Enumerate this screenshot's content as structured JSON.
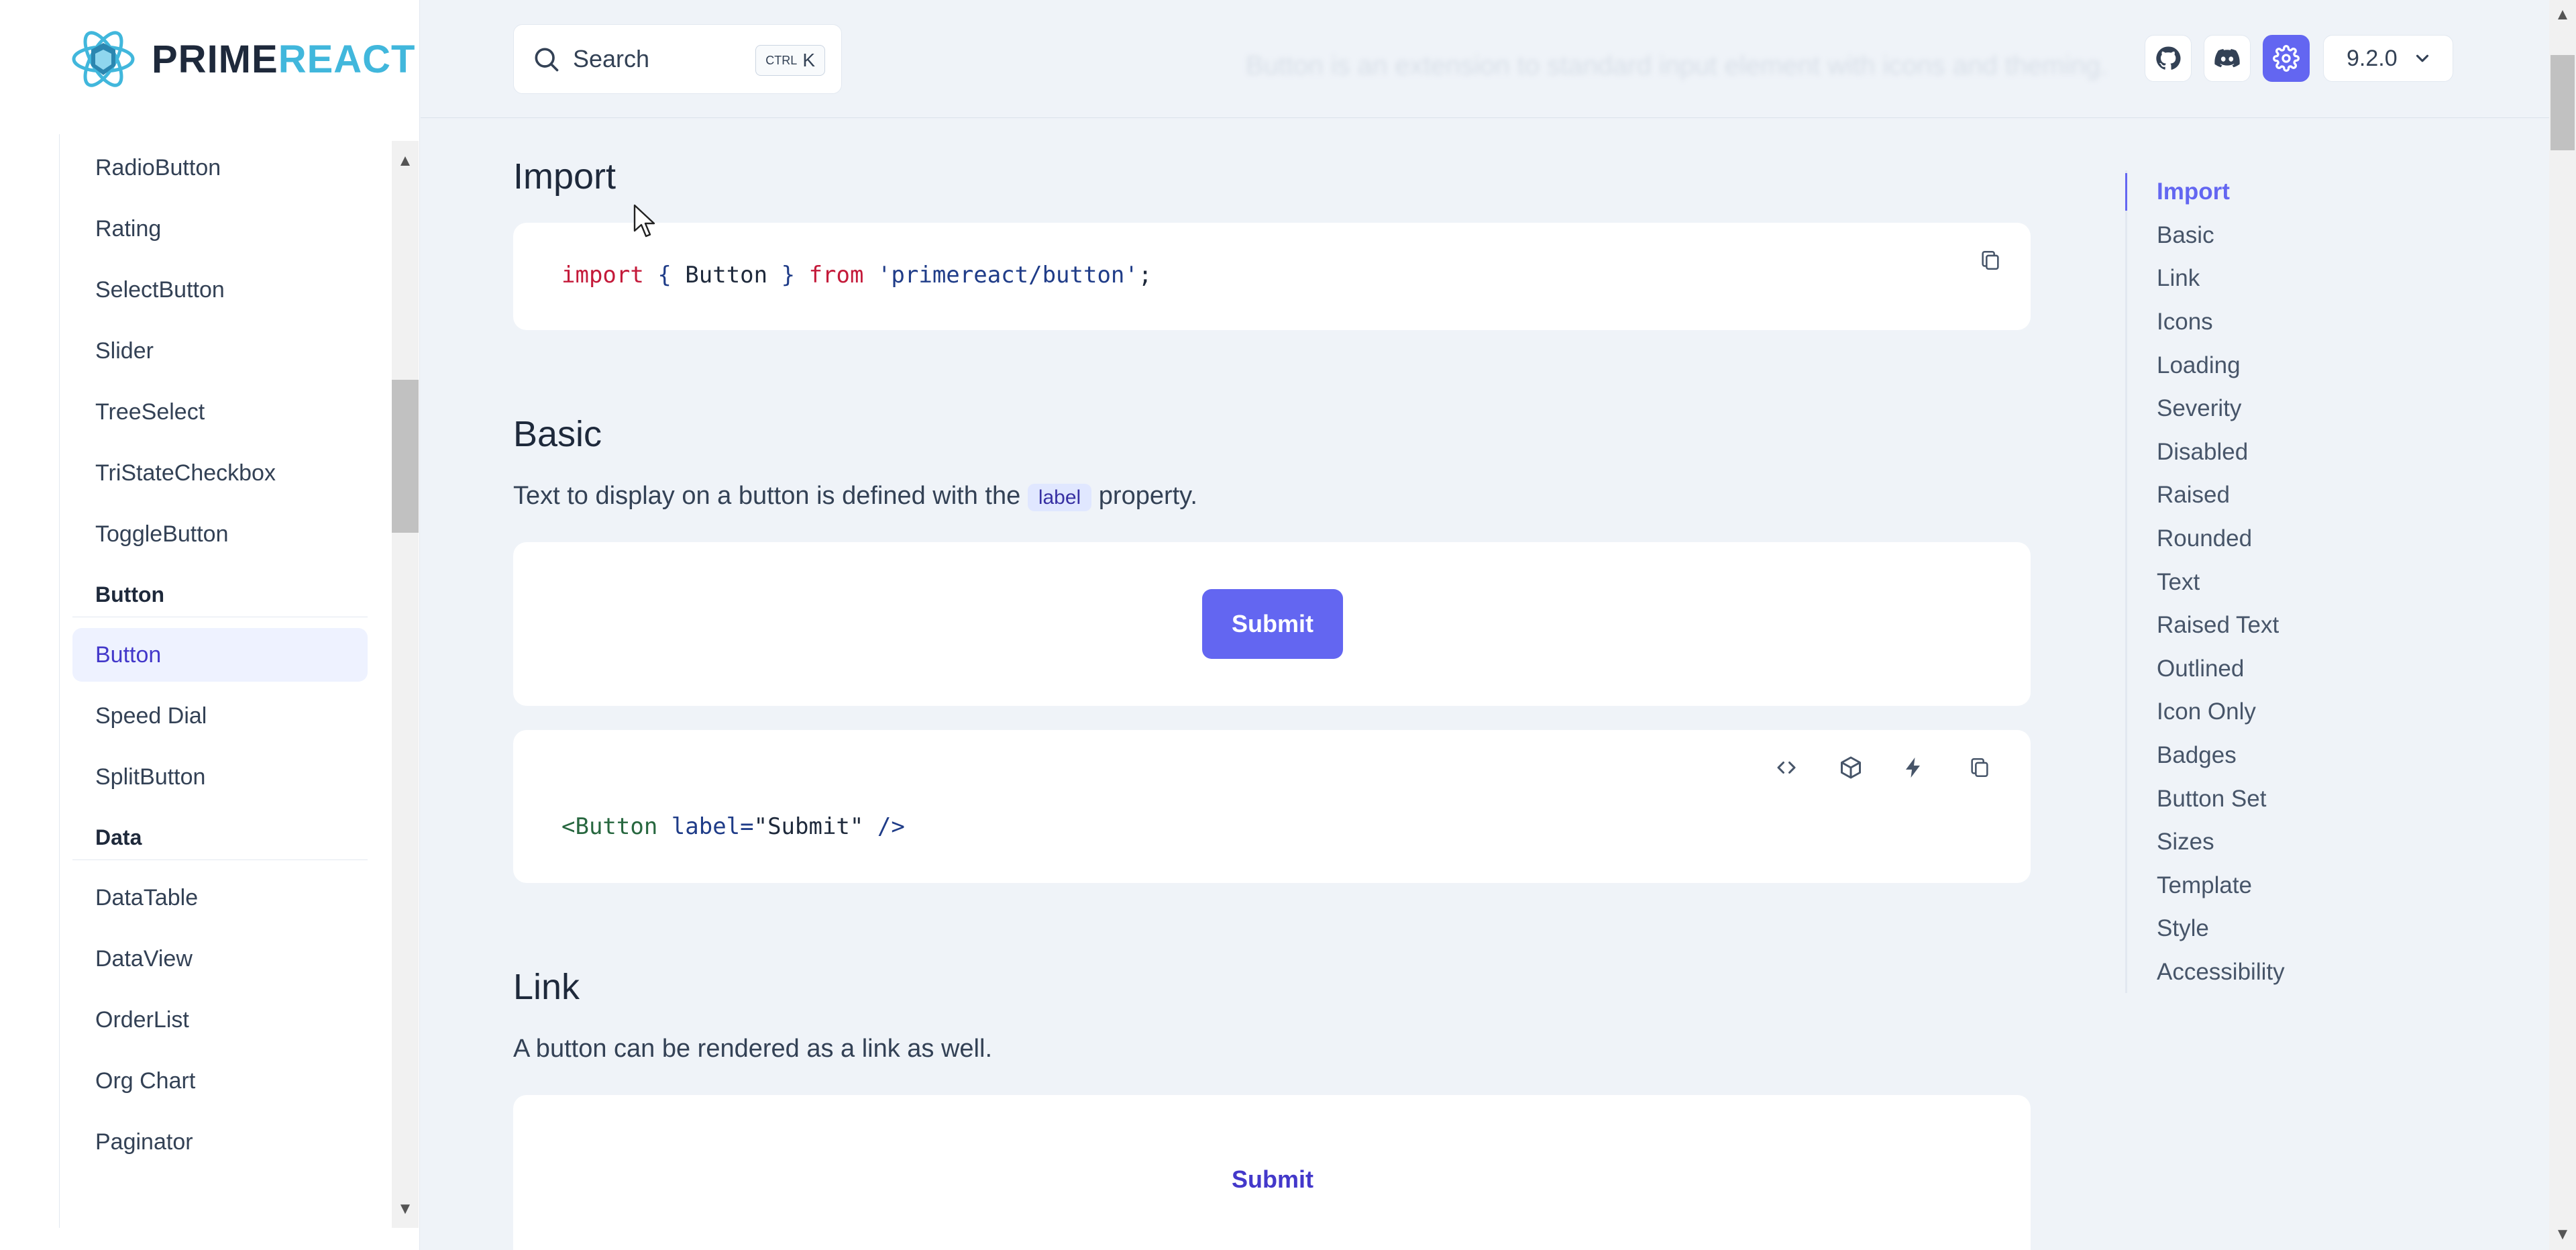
{
  "brand": {
    "name_prefix": "PRIME",
    "name_suffix": "REACT"
  },
  "search": {
    "label": "Search",
    "shortcut_mod": "CTRL",
    "shortcut_key": "K"
  },
  "topbar": {
    "version": "9.2.0",
    "faded_heading": "Button is an extension to standard input element with icons and theming."
  },
  "sidebar": {
    "items_top": [
      "RadioButton",
      "Rating",
      "SelectButton",
      "Slider",
      "TreeSelect",
      "TriStateCheckbox",
      "ToggleButton"
    ],
    "section_button": "Button",
    "items_button": [
      "Button",
      "Speed Dial",
      "SplitButton"
    ],
    "section_data": "Data",
    "items_data": [
      "DataTable",
      "DataView",
      "OrderList",
      "Org Chart",
      "Paginator"
    ]
  },
  "sections": {
    "import": {
      "title": "Import",
      "code": {
        "kw1": "import",
        "lb": "{",
        "name": "Button",
        "rb": "}",
        "kw2": "from",
        "path": "'primereact/button'",
        "semi": ";"
      }
    },
    "basic": {
      "title": "Basic",
      "desc_before": "Text to display on a button is defined with the",
      "desc_code": "label",
      "desc_after": "property.",
      "button_label": "Submit",
      "code": {
        "open": "<Button",
        "attr": "label=",
        "value": "\"Submit\"",
        "close": "/>"
      }
    },
    "link": {
      "title": "Link",
      "desc": "A button can be rendered as a link as well.",
      "button_label": "Submit"
    }
  },
  "toc": [
    "Import",
    "Basic",
    "Link",
    "Icons",
    "Loading",
    "Severity",
    "Disabled",
    "Raised",
    "Rounded",
    "Text",
    "Raised Text",
    "Outlined",
    "Icon Only",
    "Badges",
    "Button Set",
    "Sizes",
    "Template",
    "Style",
    "Accessibility"
  ],
  "colors": {
    "primary": "#6366f1",
    "brand_accent": "#41b7dc"
  }
}
